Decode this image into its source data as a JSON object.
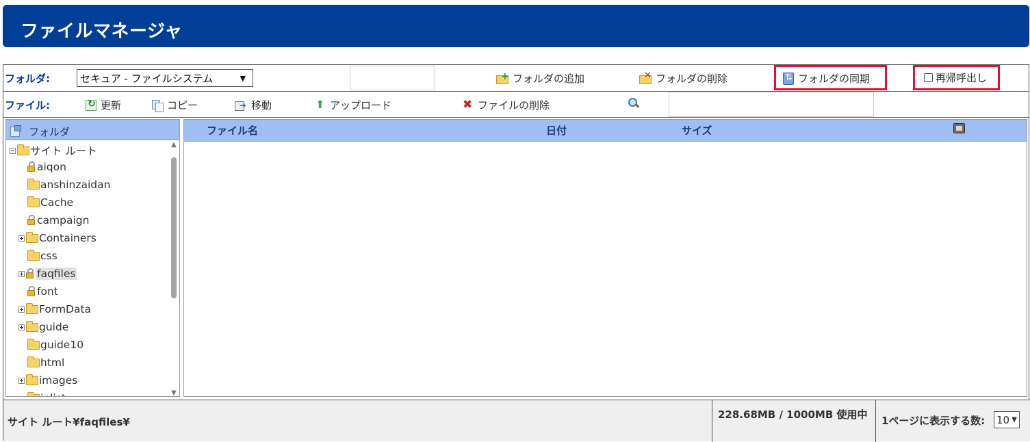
{
  "header": {
    "title": "ファイルマネージャ"
  },
  "folder_bar": {
    "label": "フォルダ:",
    "storage_selected": "セキュア - ファイルシステム",
    "add_folder": "フォルダの追加",
    "delete_folder": "フォルダの削除",
    "sync_folder": "フォルダの同期",
    "recursive_label": "再帰呼出し"
  },
  "file_bar": {
    "label": "ファイル:",
    "refresh": "更新",
    "copy": "コピー",
    "move": "移動",
    "upload": "アップロード",
    "delete_file": "ファイルの削除"
  },
  "tree": {
    "header": "フォルダ",
    "root": "サイト ルート",
    "items": [
      {
        "name": "aiqon",
        "expander": "none",
        "locked": true
      },
      {
        "name": "anshinzaidan",
        "expander": "none",
        "locked": false
      },
      {
        "name": "Cache",
        "expander": "none",
        "locked": false
      },
      {
        "name": "campaign",
        "expander": "none",
        "locked": true
      },
      {
        "name": "Containers",
        "expander": "plus",
        "locked": false
      },
      {
        "name": "css",
        "expander": "none",
        "locked": false
      },
      {
        "name": "faqfiles",
        "expander": "plus",
        "locked": true,
        "selected": true
      },
      {
        "name": "font",
        "expander": "none",
        "locked": true
      },
      {
        "name": "FormData",
        "expander": "plus",
        "locked": false
      },
      {
        "name": "guide",
        "expander": "plus",
        "locked": false
      },
      {
        "name": "guide10",
        "expander": "none",
        "locked": false
      },
      {
        "name": "html",
        "expander": "none",
        "locked": false
      },
      {
        "name": "images",
        "expander": "plus",
        "locked": false
      },
      {
        "name": "inlist",
        "expander": "none",
        "locked": false
      }
    ]
  },
  "file_list": {
    "columns": {
      "name": "ファイル名",
      "date": "日付",
      "size": "サイズ"
    },
    "rows": []
  },
  "footer": {
    "current_path": "サイト ルート¥faqfiles¥",
    "usage": "228.68MB / 1000MB 使用中",
    "per_page_label": "1ページに表示する数:",
    "per_page_value": "10"
  },
  "colors": {
    "header_bg": "#003e98",
    "panel_header_bg": "#9fbef2",
    "highlight_box": "#e2112b"
  }
}
